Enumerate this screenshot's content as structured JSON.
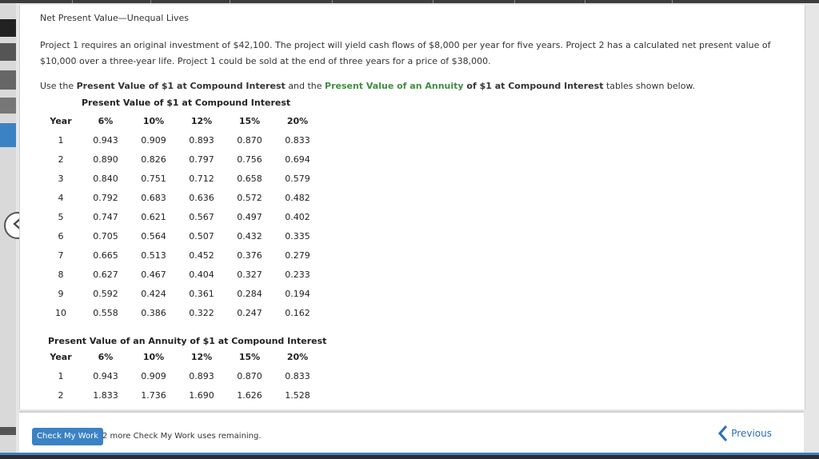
{
  "page": {
    "title": "Net Present Value—Unequal Lives",
    "paragraph1": "Project 1 requires an original investment of $42,100. The project will yield cash flows of $8,000 per year for five years. Project 2 has a calculated net present value of $10,000 over a three-year life. Project 1 could be sold at the end of three years for a price of $38,000.",
    "instruction": {
      "prefix": "Use the ",
      "table1_link": "Present Value of $1 at Compound Interest",
      "middle": " and the ",
      "table2_link": "Present Value of an Annuity",
      "table2_rest": " of $1 at Compound Interest",
      "suffix": " tables shown below."
    }
  },
  "table1": {
    "caption": "Present Value of $1 at Compound Interest",
    "headers": [
      "Year",
      "6%",
      "10%",
      "12%",
      "15%",
      "20%"
    ],
    "rows": [
      [
        "1",
        "0.943",
        "0.909",
        "0.893",
        "0.870",
        "0.833"
      ],
      [
        "2",
        "0.890",
        "0.826",
        "0.797",
        "0.756",
        "0.694"
      ],
      [
        "3",
        "0.840",
        "0.751",
        "0.712",
        "0.658",
        "0.579"
      ],
      [
        "4",
        "0.792",
        "0.683",
        "0.636",
        "0.572",
        "0.482"
      ],
      [
        "5",
        "0.747",
        "0.621",
        "0.567",
        "0.497",
        "0.402"
      ],
      [
        "6",
        "0.705",
        "0.564",
        "0.507",
        "0.432",
        "0.335"
      ],
      [
        "7",
        "0.665",
        "0.513",
        "0.452",
        "0.376",
        "0.279"
      ],
      [
        "8",
        "0.627",
        "0.467",
        "0.404",
        "0.327",
        "0.233"
      ],
      [
        "9",
        "0.592",
        "0.424",
        "0.361",
        "0.284",
        "0.194"
      ],
      [
        "10",
        "0.558",
        "0.386",
        "0.322",
        "0.247",
        "0.162"
      ]
    ]
  },
  "table2": {
    "caption": "Present Value of an Annuity of $1 at Compound Interest",
    "headers": [
      "Year",
      "6%",
      "10%",
      "12%",
      "15%",
      "20%"
    ],
    "rows": [
      [
        "1",
        "0.943",
        "0.909",
        "0.893",
        "0.870",
        "0.833"
      ],
      [
        "2",
        "1.833",
        "1.736",
        "1.690",
        "1.626",
        "1.528"
      ]
    ]
  },
  "footer": {
    "check_label": "Check My Work",
    "remaining_text": "2 more Check My Work uses remaining.",
    "previous_label": "Previous"
  },
  "colors": {
    "accent_blue": "#3b82c4",
    "link_green": "#3f8e3f"
  },
  "icons": {
    "back": "chevron-left-circle-icon",
    "previous": "chevron-left-icon"
  }
}
